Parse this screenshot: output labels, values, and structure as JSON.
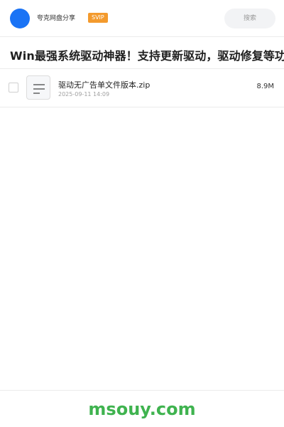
{
  "header": {
    "brand": "夸克网盘分享",
    "badge": "SVIP",
    "search_label": "搜索"
  },
  "share": {
    "title": "Win最强系统驱动神器！支持更新驱动，驱动修复等功能，"
  },
  "files": [
    {
      "name": "驱动无广告单文件版本.zip",
      "date": "2025-09-11 14:09",
      "size": "8.9M",
      "icon": "file-document-icon"
    }
  ],
  "footer": {
    "watermark": "msouy.com"
  },
  "colors": {
    "accent": "#1a73f5",
    "badge": "#f39a2d",
    "watermark": "#3fb34f"
  }
}
